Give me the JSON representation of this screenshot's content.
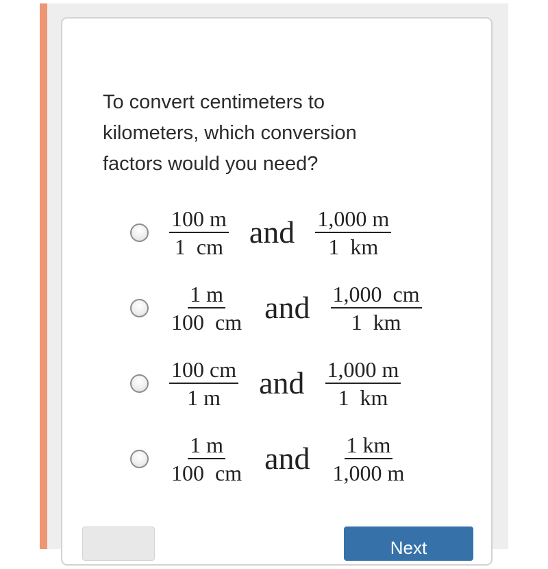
{
  "colors": {
    "accent": "#ee9673",
    "panel_bg": "#eeeeee",
    "card_bg": "#ffffff",
    "primary_button": "#3672a9"
  },
  "question": {
    "text": "To convert centimeters to kilometers, which conversion factors would you need?"
  },
  "options": [
    {
      "first": {
        "numerator": "100 m",
        "denominator": "1  cm"
      },
      "connector": "and",
      "second": {
        "numerator": "1,000 m",
        "denominator": "1  km"
      },
      "selected": false
    },
    {
      "first": {
        "numerator": "1 m",
        "denominator": "100  cm"
      },
      "connector": "and",
      "second": {
        "numerator": "1,000  cm",
        "denominator": "1  km"
      },
      "selected": false
    },
    {
      "first": {
        "numerator": "100 cm",
        "denominator": "1 m"
      },
      "connector": "and",
      "second": {
        "numerator": "1,000 m",
        "denominator": "1  km"
      },
      "selected": false
    },
    {
      "first": {
        "numerator": "1 m",
        "denominator": "100  cm"
      },
      "connector": "and",
      "second": {
        "numerator": "1 km",
        "denominator": "1,000 m"
      },
      "selected": false
    }
  ],
  "buttons": {
    "back_label": "",
    "next_label": "Next"
  }
}
